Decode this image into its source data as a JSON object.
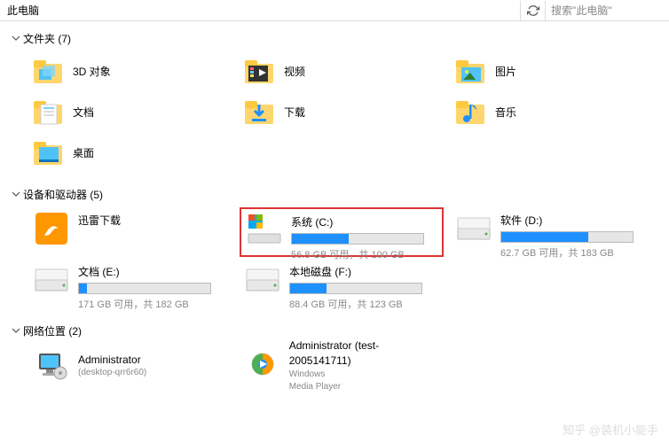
{
  "header": {
    "breadcrumb": "此电脑",
    "search_placeholder": "搜索\"此电脑\""
  },
  "sections": {
    "folders": {
      "title": "文件夹 (7)",
      "items": [
        {
          "label": "3D 对象",
          "icon": "3d"
        },
        {
          "label": "视频",
          "icon": "video"
        },
        {
          "label": "图片",
          "icon": "pictures"
        },
        {
          "label": "文档",
          "icon": "documents"
        },
        {
          "label": "下载",
          "icon": "downloads"
        },
        {
          "label": "音乐",
          "icon": "music"
        },
        {
          "label": "桌面",
          "icon": "desktop"
        }
      ]
    },
    "drives": {
      "title": "设备和驱动器 (5)",
      "items": [
        {
          "name": "迅雷下载",
          "type": "app",
          "status": "",
          "fill": 0
        },
        {
          "name": "系统 (C:)",
          "type": "os",
          "status": "56.8 GB 可用，共 100 GB",
          "fill": 43,
          "highlighted": true
        },
        {
          "name": "软件 (D:)",
          "type": "hdd",
          "status": "62.7 GB 可用，共 183 GB",
          "fill": 66
        },
        {
          "name": "文档 (E:)",
          "type": "hdd",
          "status": "171 GB 可用，共 182 GB",
          "fill": 6
        },
        {
          "name": "本地磁盘 (F:)",
          "type": "hdd",
          "status": "88.4 GB 可用，共 123 GB",
          "fill": 28
        }
      ]
    },
    "network": {
      "title": "网络位置 (2)",
      "items": [
        {
          "line1": "Administrator",
          "line2": "(desktop-qrr6r60)",
          "icon": "computer"
        },
        {
          "line1": "Administrator (test-2005141711)",
          "line2": "Windows",
          "line3": "Media Player",
          "icon": "wmp"
        }
      ]
    }
  },
  "watermark": "知乎 @装机小能手"
}
